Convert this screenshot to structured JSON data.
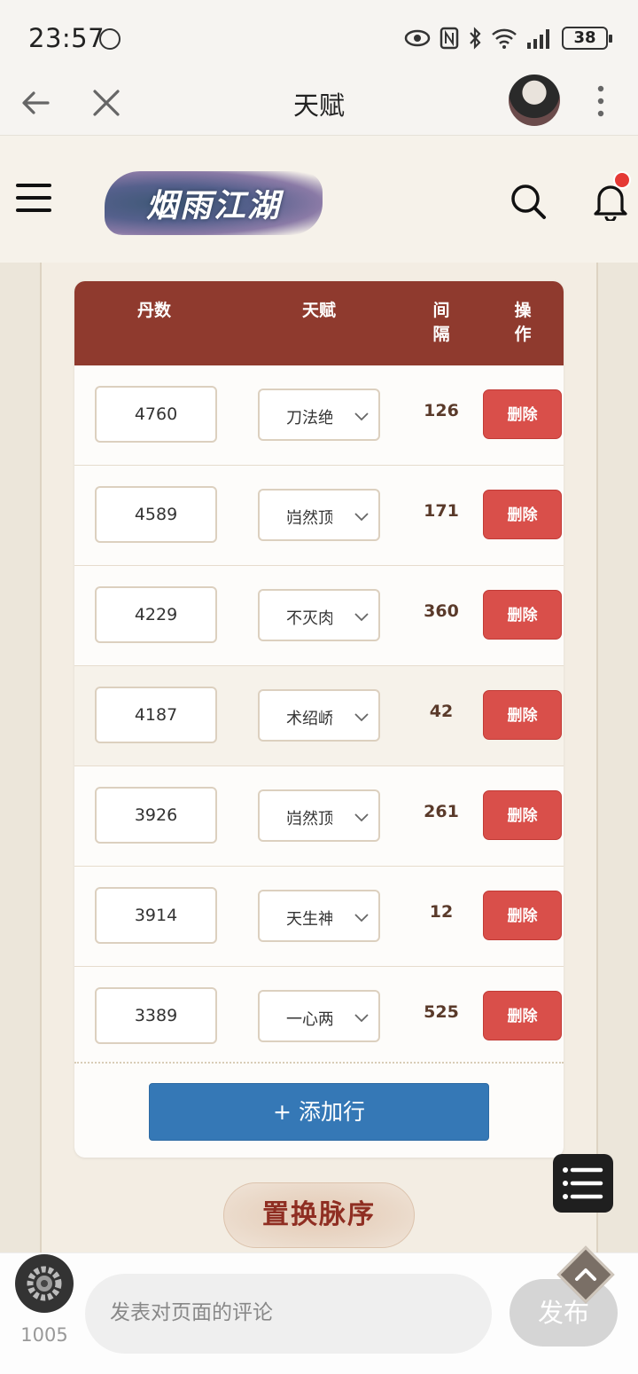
{
  "status_bar": {
    "time": "23:57",
    "battery": "38"
  },
  "nav": {
    "title": "天赋"
  },
  "site": {
    "logo_text": "烟雨江湖"
  },
  "table": {
    "headers": {
      "dan": "丹数",
      "talent": "天赋",
      "interval": "间\n隔",
      "action": "操\n作"
    },
    "rows": [
      {
        "dan": "4760",
        "talent": "刀法绝",
        "interval": "126",
        "action": "删除"
      },
      {
        "dan": "4589",
        "talent": "岿然顶",
        "interval": "171",
        "action": "删除"
      },
      {
        "dan": "4229",
        "talent": "不灭肉",
        "interval": "360",
        "action": "删除"
      },
      {
        "dan": "4187",
        "talent": "术绍峤",
        "interval": "42",
        "action": "删除"
      },
      {
        "dan": "3926",
        "talent": "岿然顶",
        "interval": "261",
        "action": "删除"
      },
      {
        "dan": "3914",
        "talent": "天生神",
        "interval": "12",
        "action": "删除"
      },
      {
        "dan": "3389",
        "talent": "一心两",
        "interval": "525",
        "action": "删除"
      }
    ],
    "add_row_label": "+ 添加行"
  },
  "replace_button": "置换脉序",
  "comment": {
    "count": "1005",
    "placeholder": "发表对页面的评论",
    "publish": "发布"
  }
}
